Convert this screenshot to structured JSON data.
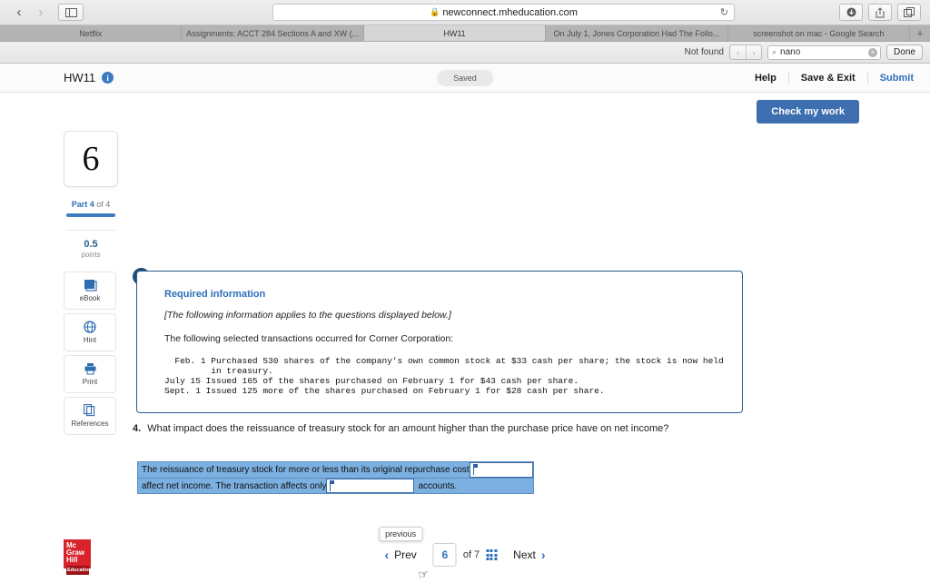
{
  "browser": {
    "back_icon": "chevron-left-icon",
    "forward_icon": "chevron-right-icon",
    "sidebar_icon": "sidebar-toggle-icon",
    "url": "newconnect.mheducation.com",
    "lock_glyph": "🔒",
    "reload_glyph": "↻",
    "download_icon": "download-icon",
    "share_icon": "share-icon",
    "tabs_overview_icon": "tabs-overview-icon",
    "new_tab_glyph": "+",
    "tabs": [
      {
        "title": "Netflix",
        "active": false
      },
      {
        "title": "Assignments: ACCT 284 Sections A and XW (...",
        "active": false
      },
      {
        "title": "HW11",
        "active": true
      },
      {
        "title": "On July 1, Jones Corporation Had The Follo...",
        "active": false
      },
      {
        "title": "screenshot on mac - Google Search",
        "active": false
      }
    ],
    "find_bar": {
      "status": "Not found",
      "prev_glyph": "‹",
      "next_glyph": "›",
      "search_glyph": "⌕",
      "query": "nano",
      "clear_glyph": "✕",
      "done_label": "Done"
    }
  },
  "header": {
    "title": "HW11",
    "info_glyph": "i",
    "saved_badge": "Saved",
    "help_label": "Help",
    "save_exit_label": "Save & Exit",
    "submit_label": "Submit",
    "check_work_label": "Check my work"
  },
  "rail": {
    "question_number": "6",
    "part_prefix": "Part 4",
    "part_suffix": " of 4",
    "progress_percent": 100,
    "points_value": "0.5",
    "points_label": "points",
    "tools": [
      {
        "label": "eBook",
        "icon": "book-icon"
      },
      {
        "label": "Hint",
        "icon": "hint-globe-icon"
      },
      {
        "label": "Print",
        "icon": "printer-icon"
      },
      {
        "label": "References",
        "icon": "references-copy-icon"
      }
    ]
  },
  "required_info": {
    "badge_glyph": "!",
    "title": "Required information",
    "subtitle": "[The following information applies to the questions displayed below.]",
    "lead": "The following selected transactions occurred for Corner Corporation:",
    "transactions": "  Feb. 1 Purchased 530 shares of the company’s own common stock at $33 cash per share; the stock is now held\n         in treasury.\nJuly 15 Issued 165 of the shares purchased on February 1 for $43 cash per share.\nSept. 1 Issued 125 more of the shares purchased on February 1 for $28 cash per share."
  },
  "question": {
    "number": "4.",
    "text": "What impact does the reissuance of treasury stock for an amount higher than the purchase price have on net income?",
    "answer_line1_text": "The reissuance of treasury stock for more or less than its original repurchase cost",
    "answer_input1_value": "",
    "answer_line2_text": "affect net income. The transaction affects only",
    "answer_input2_value": "",
    "answer_line2_tail": "accounts."
  },
  "footer": {
    "logo_line1": "Mc",
    "logo_line2": "Graw",
    "logo_line3": "Hill",
    "logo_line4": "Education",
    "prev_label": "Prev",
    "prev_arrow": "‹",
    "prev_tooltip": "previous",
    "page_current": "6",
    "page_of": "of 7",
    "grid_icon": "grid-icon",
    "next_label": "Next",
    "next_arrow": "›"
  },
  "colors": {
    "accent_blue": "#2c6fba",
    "button_blue": "#3d6fb0",
    "answer_highlight": "#7cb0e0",
    "logo_red": "#d8232a"
  }
}
